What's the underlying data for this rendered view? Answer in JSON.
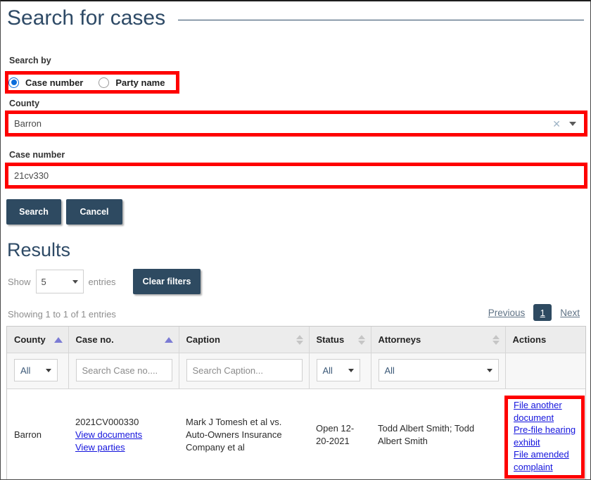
{
  "page": {
    "title": "Search for cases"
  },
  "form": {
    "search_by_label": "Search by",
    "radios": [
      {
        "label": "Case number",
        "checked": true
      },
      {
        "label": "Party name",
        "checked": false
      }
    ],
    "county_label": "County",
    "county_value": "Barron",
    "county_clear_icon": "clear-x-icon",
    "county_caret_icon": "chevron-down-icon",
    "case_number_label": "Case number",
    "case_number_value": "21cv330",
    "search_button": "Search",
    "cancel_button": "Cancel"
  },
  "results": {
    "heading": "Results",
    "show_label": "Show",
    "show_value": "5",
    "entries_label": "entries",
    "clear_filters_button": "Clear filters",
    "showing_info": "Showing 1 to 1 of 1 entries",
    "pagination": {
      "previous": "Previous",
      "current_page": "1",
      "next": "Next"
    },
    "columns": [
      {
        "label": "County",
        "sort": "asc"
      },
      {
        "label": "Case no.",
        "sort": "asc"
      },
      {
        "label": "Caption",
        "sort": "none"
      },
      {
        "label": "Status",
        "sort": "none"
      },
      {
        "label": "Attorneys",
        "sort": "none"
      },
      {
        "label": "Actions",
        "sort": null
      }
    ],
    "filters": {
      "county": "All",
      "case_no_placeholder": "Search Case no....",
      "caption_placeholder": "Search Caption...",
      "status": "All",
      "attorneys": "All"
    },
    "rows": [
      {
        "county": "Barron",
        "case_no": "2021CV000330",
        "case_links": [
          "View documents",
          "View parties"
        ],
        "caption": "Mark J Tomesh et al vs. Auto-Owners   Insurance Company et al",
        "status": "Open 12-20-2021",
        "attorneys": "Todd Albert Smith; Todd Albert Smith",
        "actions": [
          "File another document",
          "Pre-file hearing exhibit",
          "File amended complaint"
        ]
      }
    ]
  },
  "annotations": {
    "highlight_color": "#fe0000",
    "boxes": [
      "search-by-radios",
      "county-field",
      "case-number-field",
      "actions-cell"
    ]
  },
  "theme": {
    "accent": "#2e4a61",
    "title_color": "#2e4a66",
    "link_color": "#1414dd",
    "radio_selected": "#0b6ddb",
    "sort_active": "#7b7bd4"
  }
}
